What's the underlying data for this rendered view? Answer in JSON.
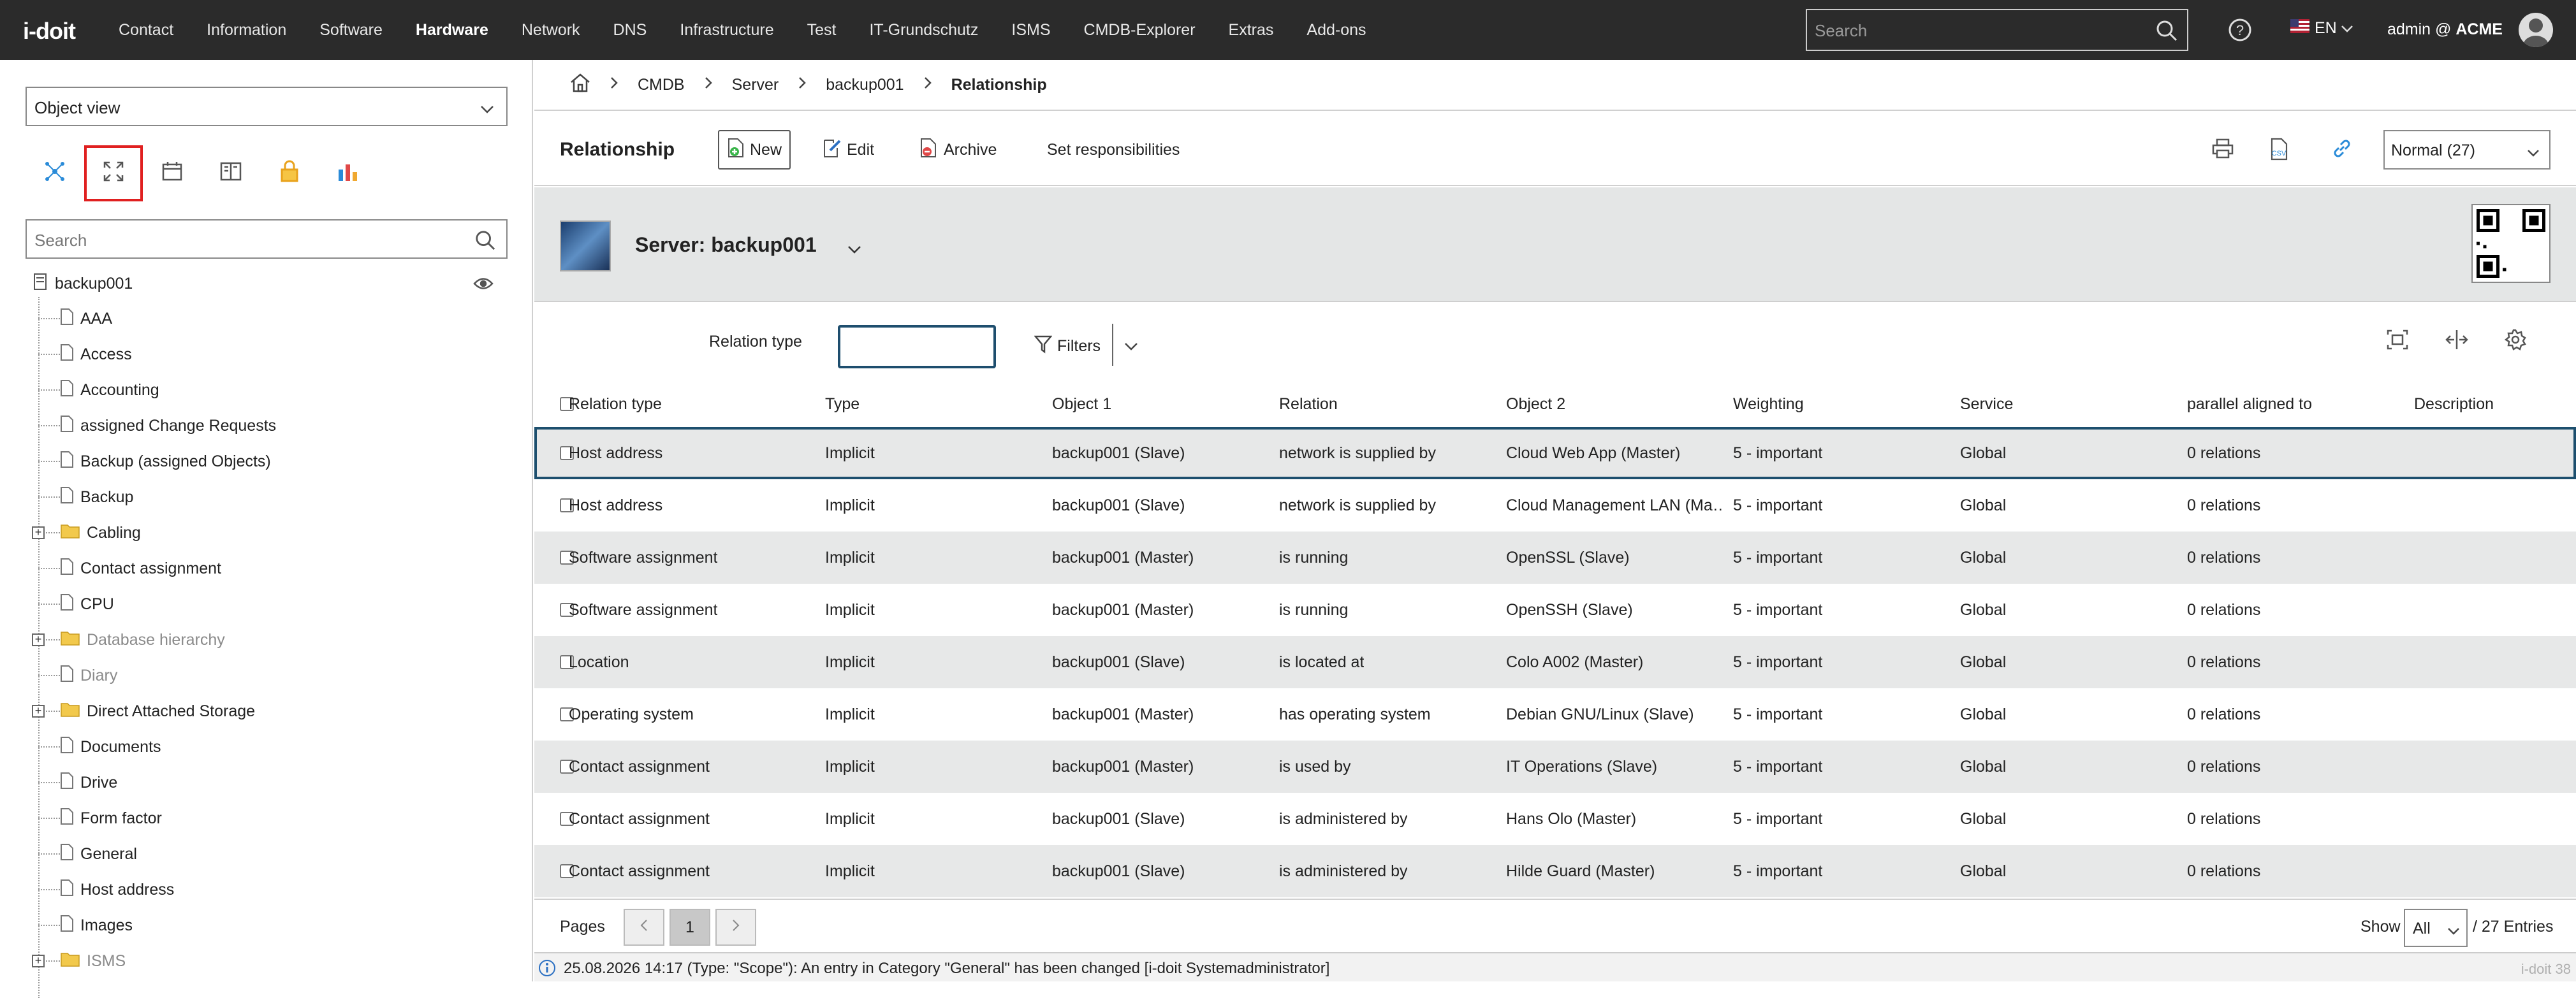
{
  "app": {
    "logo": "i-doit"
  },
  "nav": [
    "Contact",
    "Information",
    "Software",
    "Hardware",
    "Network",
    "DNS",
    "Infrastructure",
    "Test",
    "IT-Grundschutz",
    "ISMS",
    "CMDB-Explorer",
    "Extras",
    "Add-ons"
  ],
  "nav_active": "Hardware",
  "search": {
    "placeholder": "Search"
  },
  "lang": "EN",
  "user": {
    "prefix": "admin @ ",
    "tenant": "ACME"
  },
  "sidebar": {
    "view_select": "Object view",
    "search_placeholder": "Search",
    "root": "backup001",
    "items": [
      {
        "label": "AAA",
        "type": "doc",
        "grey": false
      },
      {
        "label": "Access",
        "type": "doc",
        "grey": false
      },
      {
        "label": "Accounting",
        "type": "doc",
        "grey": false
      },
      {
        "label": "assigned Change Requests",
        "type": "doc",
        "grey": false
      },
      {
        "label": "Backup (assigned Objects)",
        "type": "doc",
        "grey": false
      },
      {
        "label": "Backup",
        "type": "doc",
        "grey": false
      },
      {
        "label": "Cabling",
        "type": "folder",
        "grey": false
      },
      {
        "label": "Contact assignment",
        "type": "doc",
        "grey": false
      },
      {
        "label": "CPU",
        "type": "doc",
        "grey": false
      },
      {
        "label": "Database hierarchy",
        "type": "folder",
        "grey": true
      },
      {
        "label": "Diary",
        "type": "doc",
        "grey": true
      },
      {
        "label": "Direct Attached Storage",
        "type": "folder",
        "grey": false
      },
      {
        "label": "Documents",
        "type": "doc",
        "grey": false
      },
      {
        "label": "Drive",
        "type": "doc",
        "grey": false
      },
      {
        "label": "Form factor",
        "type": "doc",
        "grey": false
      },
      {
        "label": "General",
        "type": "doc",
        "grey": false
      },
      {
        "label": "Host address",
        "type": "doc",
        "grey": false
      },
      {
        "label": "Images",
        "type": "doc",
        "grey": false
      },
      {
        "label": "ISMS",
        "type": "folder",
        "grey": true
      }
    ]
  },
  "breadcrumb": [
    "CMDB",
    "Server",
    "backup001",
    "Relationship"
  ],
  "toolbar": {
    "title": "Relationship",
    "new": "New",
    "edit": "Edit",
    "archive": "Archive",
    "responsibilities": "Set responsibilities",
    "size_select": "Normal (27)"
  },
  "object": {
    "title": "Server: backup001"
  },
  "filter": {
    "relation_type_label": "Relation type",
    "filters": "Filters"
  },
  "table": {
    "columns": [
      "Relation type",
      "Type",
      "Object 1",
      "Relation",
      "Object 2",
      "Weighting",
      "Service",
      "parallel aligned to",
      "Description"
    ],
    "rows": [
      [
        "Host address",
        "Implicit",
        "backup001 (Slave)",
        "network is supplied by",
        "Cloud Web App (Master)",
        "5 - important",
        "Global",
        "0 relations",
        ""
      ],
      [
        "Host address",
        "Implicit",
        "backup001 (Slave)",
        "network is supplied by",
        "Cloud Management LAN (Ma…",
        "5 - important",
        "Global",
        "0 relations",
        ""
      ],
      [
        "Software assignment",
        "Implicit",
        "backup001 (Master)",
        "is running",
        "OpenSSL (Slave)",
        "5 - important",
        "Global",
        "0 relations",
        ""
      ],
      [
        "Software assignment",
        "Implicit",
        "backup001 (Master)",
        "is running",
        "OpenSSH (Slave)",
        "5 - important",
        "Global",
        "0 relations",
        ""
      ],
      [
        "Location",
        "Implicit",
        "backup001 (Slave)",
        "is located at",
        "Colo A002 (Master)",
        "5 - important",
        "Global",
        "0 relations",
        ""
      ],
      [
        "Operating system",
        "Implicit",
        "backup001 (Master)",
        "has operating system",
        "Debian GNU/Linux (Slave)",
        "5 - important",
        "Global",
        "0 relations",
        ""
      ],
      [
        "Contact assignment",
        "Implicit",
        "backup001 (Master)",
        "is used by",
        "IT Operations (Slave)",
        "5 - important",
        "Global",
        "0 relations",
        ""
      ],
      [
        "Contact assignment",
        "Implicit",
        "backup001 (Slave)",
        "is administered by",
        "Hans Olo (Master)",
        "5 - important",
        "Global",
        "0 relations",
        ""
      ],
      [
        "Contact assignment",
        "Implicit",
        "backup001 (Slave)",
        "is administered by",
        "Hilde Guard (Master)",
        "5 - important",
        "Global",
        "0 relations",
        ""
      ]
    ]
  },
  "pager": {
    "label": "Pages",
    "current": "1",
    "show_label": "Show",
    "show_value": "All",
    "entries": "/ 27 Entries"
  },
  "status": {
    "message": "25.08.2026 14:17 (Type: \"Scope\"): An entry in Category \"General\" has been changed [i-doit Systemadministrator]",
    "version": "i-doit 38"
  },
  "colors": {
    "topbar": "#2b2b2b",
    "highlight_border": "#1d4f6e",
    "selected_tool": "#e02020",
    "accent_blue": "#2a8bd8"
  }
}
